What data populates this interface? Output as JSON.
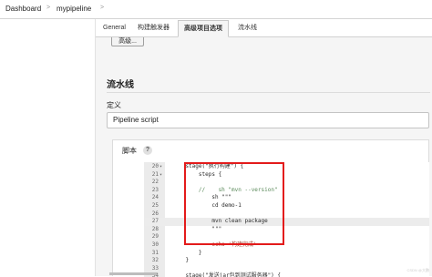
{
  "breadcrumb": {
    "items": [
      "Dashboard",
      "mypipeline"
    ],
    "separator": ">"
  },
  "tabs": [
    {
      "label": "General",
      "active": false
    },
    {
      "label": "构建触发器",
      "active": false
    },
    {
      "label": "高级项目选项",
      "active": true
    },
    {
      "label": "流水线",
      "active": false
    }
  ],
  "advanced_button": "高级...",
  "section": {
    "title": "流水线",
    "definition_label": "定义",
    "definition_value": "Pipeline script"
  },
  "script": {
    "label": "脚本",
    "help_icon": "?",
    "lines": [
      {
        "num": "20",
        "fold": "▾",
        "text": "    stage(\"执行构建\") {",
        "kind": "code"
      },
      {
        "num": "21",
        "fold": "▾",
        "text": "        steps {",
        "kind": "code"
      },
      {
        "num": "22",
        "fold": "",
        "text": "",
        "kind": "code"
      },
      {
        "num": "23",
        "fold": "",
        "text": "        //    sh \"mvn --version\"",
        "kind": "comment"
      },
      {
        "num": "24",
        "fold": "",
        "text": "            sh \"\"\"",
        "kind": "code"
      },
      {
        "num": "25",
        "fold": "",
        "text": "            cd demo-1",
        "kind": "code"
      },
      {
        "num": "26",
        "fold": "",
        "text": "",
        "kind": "code"
      },
      {
        "num": "27",
        "fold": "",
        "text": "            mvn clean package",
        "kind": "code",
        "current": true
      },
      {
        "num": "28",
        "fold": "",
        "text": "            \"\"\"",
        "kind": "code"
      },
      {
        "num": "29",
        "fold": "",
        "text": "",
        "kind": "code"
      },
      {
        "num": "30",
        "fold": "",
        "text": "            echo '构建完成'",
        "kind": "string"
      },
      {
        "num": "31",
        "fold": "",
        "text": "        }",
        "kind": "code"
      },
      {
        "num": "32",
        "fold": "",
        "text": "    }",
        "kind": "code"
      },
      {
        "num": "33",
        "fold": "",
        "text": "",
        "kind": "code"
      },
      {
        "num": "34",
        "fold": "",
        "text": "    stage(\"发送jar包到测试服务器\") {",
        "kind": "code"
      }
    ]
  },
  "watermark": "CSDN @大鹏",
  "colors": {
    "highlight_box": "#e31b1b",
    "page_bg": "#f5f5f5"
  }
}
